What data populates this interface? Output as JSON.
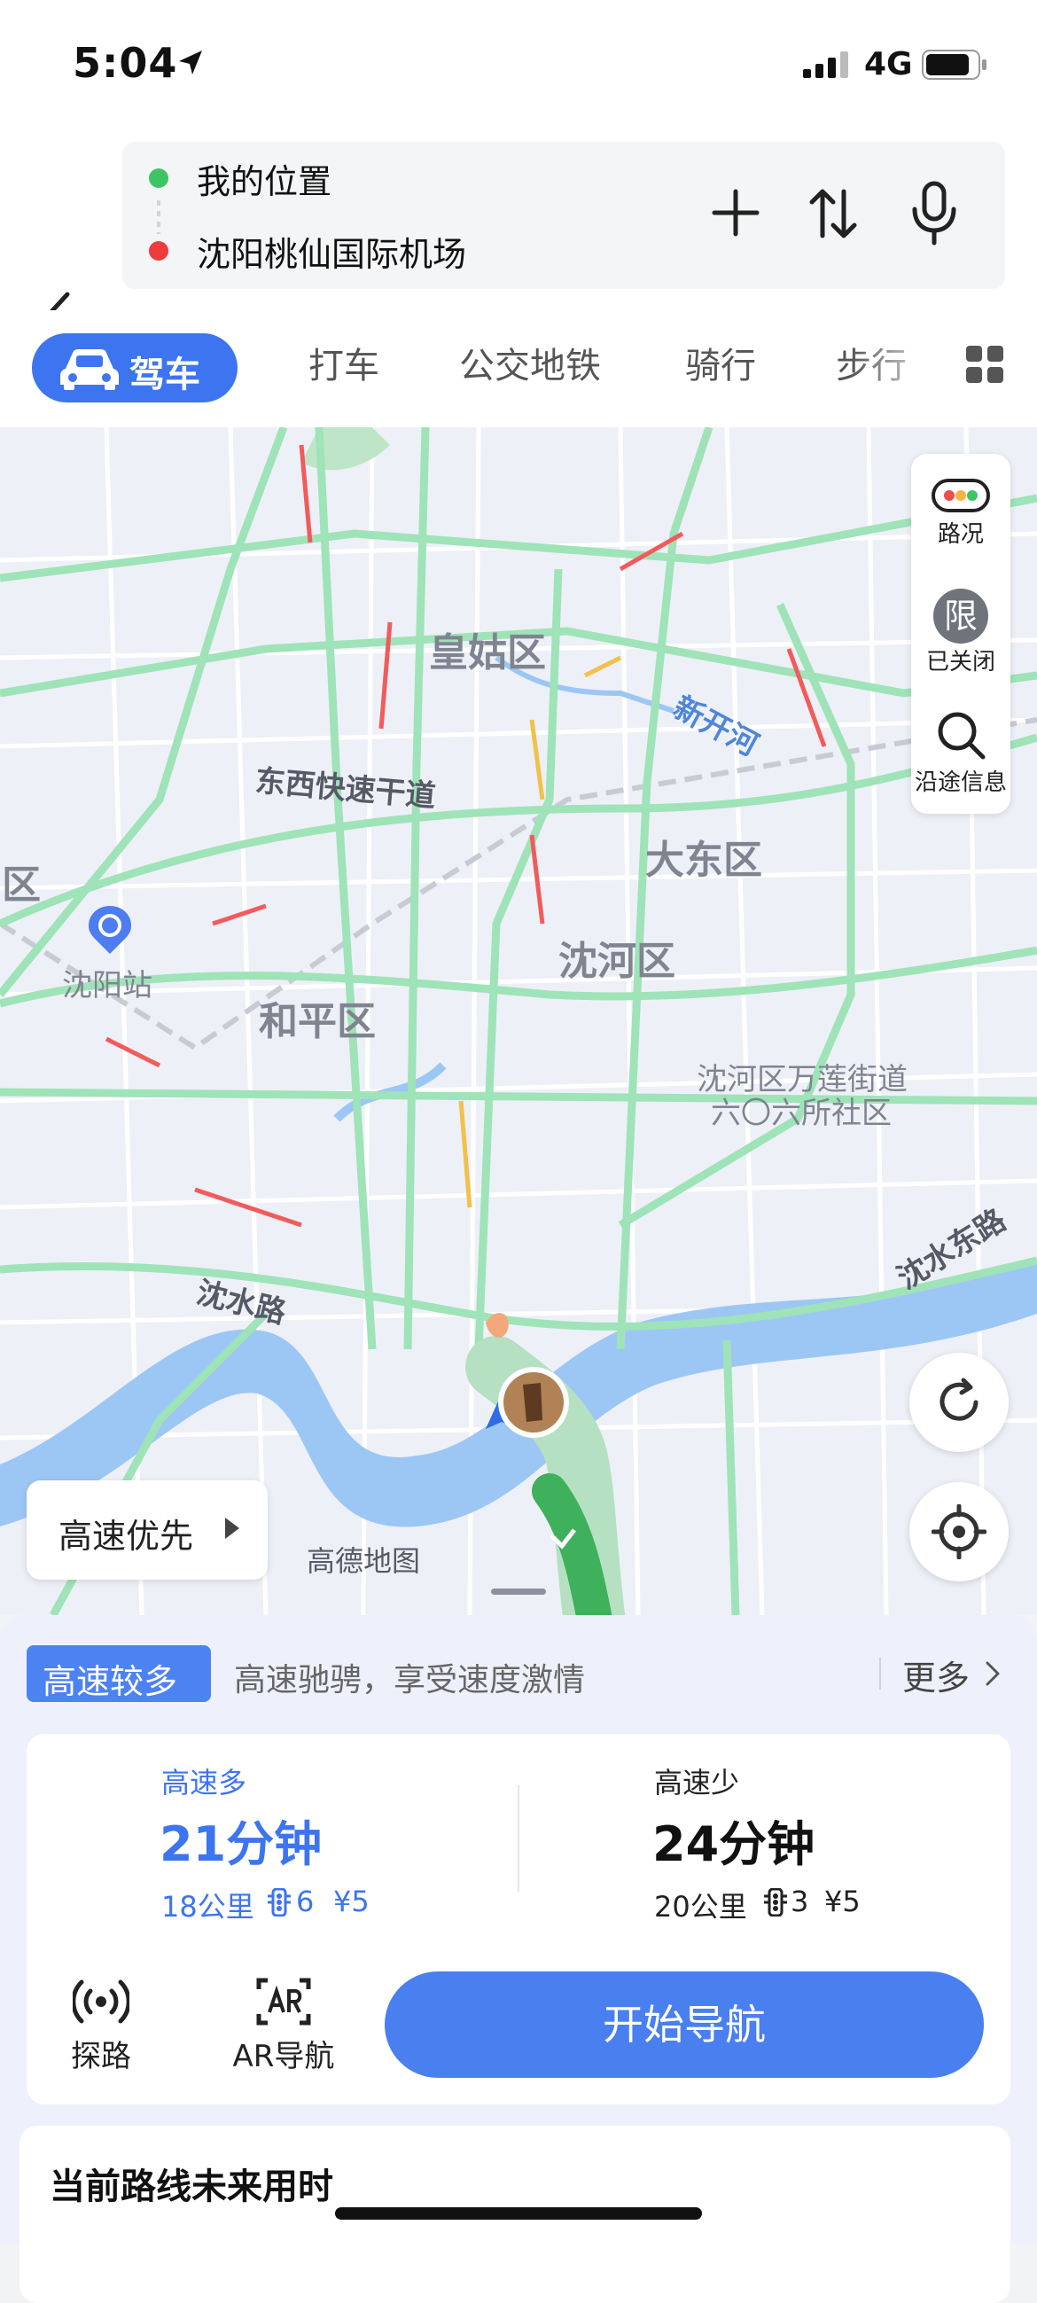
{
  "status_bar": {
    "time": "5:04",
    "network": "4G"
  },
  "route": {
    "origin": "我的位置",
    "destination": "沈阳桃仙国际机场"
  },
  "tabs": [
    {
      "label": "驾车",
      "active": true
    },
    {
      "label": "打车"
    },
    {
      "label": "公交地铁"
    },
    {
      "label": "骑行"
    },
    {
      "label": "步行"
    }
  ],
  "map": {
    "districts": [
      "皇姑区",
      "大东区",
      "沈河区",
      "和平区",
      "区"
    ],
    "roads": [
      "东西快速干道",
      "沈水路",
      "沈水东路"
    ],
    "rivers": [
      "新开河"
    ],
    "places": [
      "沈阳站",
      "沈河区万莲街道",
      "六〇六所社区"
    ],
    "watermark": "高德地图",
    "controls": {
      "traffic": "路况",
      "restriction_icon": "限",
      "restriction": "已关闭",
      "along_route": "沿途信息"
    },
    "preference": "高速优先"
  },
  "highlight": {
    "tag": "高速较多",
    "desc": "高速驰骋，享受速度激情",
    "more": "更多"
  },
  "options": [
    {
      "label": "高速多",
      "time": "21分钟",
      "distance": "18公里",
      "lights": "6",
      "toll": "¥5",
      "selected": true
    },
    {
      "label": "高速少",
      "time": "24分钟",
      "distance": "20公里",
      "lights": "3",
      "toll": "¥5",
      "selected": false
    }
  ],
  "tools": [
    {
      "label": "探路"
    },
    {
      "label": "AR导航"
    }
  ],
  "start_nav": "开始导航",
  "future_title": "当前路线未来用时",
  "colors": {
    "accent": "#3d74f0",
    "road": "#9fe3b8",
    "water": "#9cc7f5",
    "route": "#3fb05c"
  }
}
